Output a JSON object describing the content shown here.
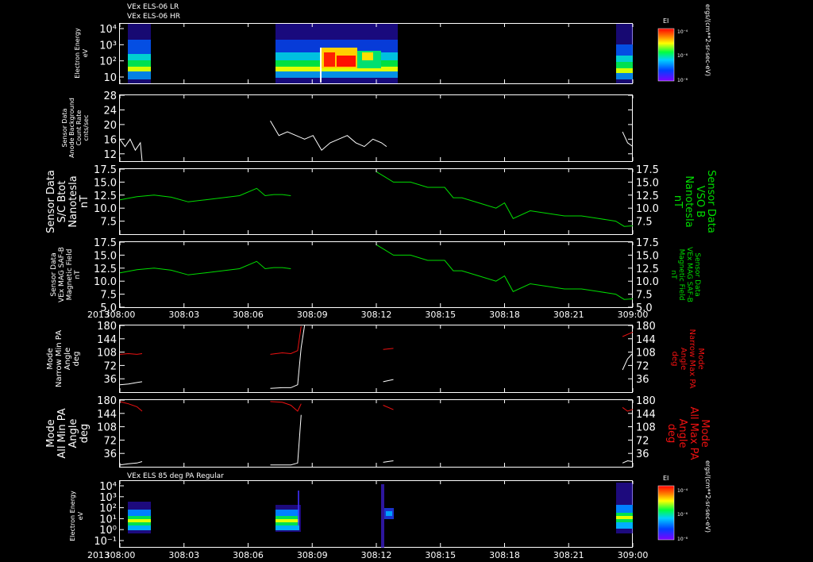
{
  "time_ticks": [
    "308:00",
    "308:03",
    "308:06",
    "308:09",
    "308:12",
    "308:15",
    "308:18",
    "308:21",
    "309:00"
  ],
  "year": "2013",
  "top_title": [
    "VEx ELS-06 LR",
    "VEx ELS-06 HR"
  ],
  "bottom_title": "VEx ELS 85 deg PA Regular",
  "colorbar": {
    "label": "EI",
    "ticks": [
      "10⁻⁴",
      "10⁻⁶",
      "10⁻⁸"
    ],
    "unit": "ergs/(cm**2-sr-sec-eV)"
  },
  "colors": {
    "white": "#ffffff",
    "green": "#00dd00",
    "red": "#ee1111",
    "background": "#000000"
  },
  "chart_data": [
    {
      "type": "heatmap",
      "id": "spec1",
      "ylabel": [
        "Electron Energy",
        "eV"
      ],
      "ytick_labels": [
        "10⁴",
        "10³",
        "10²",
        "10"
      ],
      "ylog": true,
      "ylim": [
        1,
        20000
      ],
      "x_unit": "minutes since 308:00",
      "data_segments": [
        [
          0,
          1.3
        ],
        [
          8.8,
          15.6
        ],
        [
          29.4,
          30
        ]
      ]
    },
    {
      "type": "line",
      "id": "counts",
      "ylabel": [
        "Sensor Data",
        "Anode Background",
        "Count Rate",
        "cnts/sec"
      ],
      "ylim": [
        10,
        28
      ],
      "yticks": [
        12,
        16,
        20,
        24,
        28
      ],
      "color": "white",
      "segments": [
        {
          "x": [
            0,
            0.3,
            0.6,
            0.9,
            1.2,
            1.3
          ],
          "y": [
            16,
            14,
            16,
            13,
            15,
            10
          ]
        },
        {
          "x": [
            8.8,
            9.3,
            9.8,
            10.3,
            10.8,
            11.3,
            11.8,
            12.3,
            12.8,
            13.3,
            13.8,
            14.3,
            14.8,
            15.3,
            15.6
          ],
          "y": [
            21,
            17,
            18,
            17,
            16,
            17,
            13,
            15,
            16,
            17,
            15,
            14,
            16,
            15,
            14
          ]
        },
        {
          "x": [
            29.4,
            29.7,
            30
          ],
          "y": [
            18,
            15,
            14
          ]
        }
      ]
    },
    {
      "type": "line",
      "id": "bx",
      "ylabel": [
        "Sensor Data",
        "S/C Btot",
        "Nanotesla",
        "nT"
      ],
      "ylabel_right": [
        "Sensor Data",
        "VSO B",
        "Nanotesla",
        "nT"
      ],
      "ylim": [
        5,
        17.5
      ],
      "yticks": [
        7.5,
        10,
        12.5,
        15,
        17.5
      ],
      "color": "green",
      "segments": [
        {
          "x": [
            0,
            1,
            2,
            3,
            4,
            5,
            6,
            7,
            8,
            8.5,
            9,
            9.5,
            10
          ],
          "y": [
            11.6,
            12.2,
            12.5,
            12.1,
            11.2,
            11.6,
            12.0,
            12.4,
            13.8,
            12.4,
            12.6,
            12.6,
            12.4
          ]
        },
        {
          "x": [
            15,
            15.5,
            16,
            17,
            18,
            19,
            19.5,
            20,
            21,
            22,
            22.5,
            23,
            24,
            25,
            26,
            27,
            28,
            29,
            29.5,
            30
          ],
          "y": [
            17,
            16,
            15,
            15,
            14,
            14,
            12,
            12,
            11,
            10,
            11,
            8,
            9.5,
            9,
            8.5,
            8.5,
            8,
            7.5,
            6.5,
            6.6
          ]
        }
      ]
    },
    {
      "type": "line",
      "id": "bsaf",
      "ylabel": [
        "Sensor Data",
        "VEx MAG SAF-B",
        "Magnetic Field",
        "nT"
      ],
      "ylabel_right": [
        "Sensor Data",
        "VEx MAG SAF-B",
        "Magnetic Field",
        "nT"
      ],
      "ylim": [
        5,
        17.5
      ],
      "yticks": [
        5,
        7.5,
        10,
        12.5,
        15,
        17.5
      ],
      "color": "green",
      "segments": [
        {
          "x": [
            0,
            1,
            2,
            3,
            4,
            5,
            6,
            7,
            8,
            8.5,
            9,
            9.5,
            10
          ],
          "y": [
            11.6,
            12.2,
            12.5,
            12.1,
            11.2,
            11.6,
            12.0,
            12.4,
            13.8,
            12.4,
            12.6,
            12.6,
            12.4
          ]
        },
        {
          "x": [
            15,
            15.5,
            16,
            17,
            18,
            19,
            19.5,
            20,
            21,
            22,
            22.5,
            23,
            24,
            25,
            26,
            27,
            28,
            29,
            29.5,
            30
          ],
          "y": [
            17,
            16,
            15,
            15,
            14,
            14,
            12,
            12,
            11,
            10,
            11,
            8,
            9.5,
            9,
            8.5,
            8.5,
            8,
            7.5,
            6.5,
            6.6
          ]
        }
      ]
    },
    {
      "type": "line",
      "id": "npa",
      "ylabel": [
        "Mode",
        "Narrow Min PA",
        "Angle",
        "deg"
      ],
      "ylabel_right": [
        "Mode",
        "Narrow Max PA",
        "Angle",
        "deg"
      ],
      "ylim": [
        0,
        180
      ],
      "yticks": [
        36,
        72,
        108,
        144,
        180
      ],
      "series": [
        {
          "name": "min",
          "color": "white",
          "segments": [
            {
              "x": [
                0,
                0.5,
                1,
                1.3
              ],
              "y": [
                20,
                22,
                26,
                28
              ]
            },
            {
              "x": [
                8.8,
                9.5,
                10,
                10.4,
                10.6,
                10.8
              ],
              "y": [
                10,
                12,
                12,
                20,
                120,
                180
              ]
            },
            {
              "x": [
                15.4,
                16
              ],
              "y": [
                28,
                34
              ]
            },
            {
              "x": [
                29.4,
                29.7,
                30
              ],
              "y": [
                60,
                90,
                105
              ]
            }
          ]
        },
        {
          "name": "max",
          "color": "red",
          "segments": [
            {
              "x": [
                0,
                0.5,
                1,
                1.3
              ],
              "y": [
                102,
                104,
                102,
                104
              ]
            },
            {
              "x": [
                8.8,
                9.5,
                10,
                10.4,
                10.6
              ],
              "y": [
                102,
                106,
                104,
                112,
                178
              ]
            },
            {
              "x": [
                15.4,
                16
              ],
              "y": [
                115,
                118
              ]
            },
            {
              "x": [
                29.4,
                29.7,
                30
              ],
              "y": [
                150,
                156,
                162
              ]
            }
          ]
        }
      ]
    },
    {
      "type": "line",
      "id": "apa",
      "ylabel": [
        "Mode",
        "All Min PA",
        "Angle",
        "deg"
      ],
      "ylabel_right": [
        "Mode",
        "All Max PA",
        "Angle",
        "deg"
      ],
      "ylim": [
        0,
        180
      ],
      "yticks": [
        36,
        72,
        108,
        144,
        180
      ],
      "series": [
        {
          "name": "min",
          "color": "white",
          "segments": [
            {
              "x": [
                0,
                0.5,
                1,
                1.3
              ],
              "y": [
                5,
                8,
                10,
                14
              ]
            },
            {
              "x": [
                8.8,
                9.5,
                10,
                10.4,
                10.6
              ],
              "y": [
                5,
                5,
                5,
                10,
                140
              ]
            },
            {
              "x": [
                15.4,
                16
              ],
              "y": [
                12,
                16
              ]
            },
            {
              "x": [
                29.4,
                29.7,
                30
              ],
              "y": [
                10,
                16,
                14
              ]
            }
          ]
        },
        {
          "name": "max",
          "color": "red",
          "segments": [
            {
              "x": [
                0,
                0.5,
                1,
                1.3
              ],
              "y": [
                176,
                170,
                162,
                150
              ]
            },
            {
              "x": [
                8.8,
                9.5,
                10,
                10.4,
                10.6
              ],
              "y": [
                176,
                174,
                166,
                150,
                170
              ]
            },
            {
              "x": [
                15.4,
                16
              ],
              "y": [
                166,
                154
              ]
            },
            {
              "x": [
                29.4,
                29.7,
                30
              ],
              "y": [
                160,
                150,
                155
              ]
            }
          ]
        }
      ]
    },
    {
      "type": "heatmap",
      "id": "spec2",
      "ylabel": [
        "Electron Energy",
        "eV"
      ],
      "ytick_labels": [
        "10⁴",
        "10³",
        "10²",
        "10¹",
        "10⁰",
        "10⁻¹"
      ],
      "ylog": true,
      "ylim": [
        0.1,
        20000
      ],
      "x_unit": "minutes since 308:00",
      "data_segments": [
        [
          0,
          1.3
        ],
        [
          8.8,
          10.3
        ],
        [
          15.3,
          16.1
        ],
        [
          29.4,
          30
        ]
      ]
    }
  ]
}
